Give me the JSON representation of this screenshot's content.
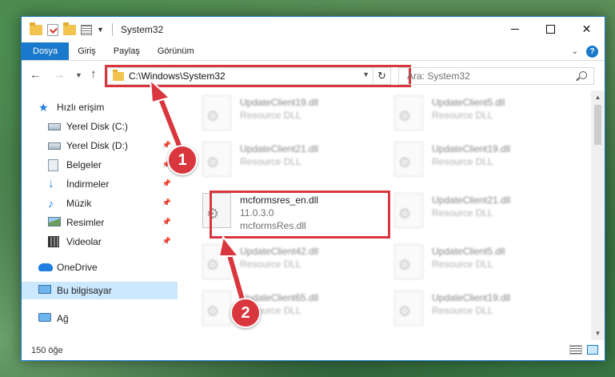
{
  "window": {
    "title": "System32",
    "controls": {
      "minimize": "",
      "maximize": "",
      "close": "✕"
    }
  },
  "ribbon": {
    "tabs": [
      "Dosya",
      "Giriş",
      "Paylaş",
      "Görünüm"
    ],
    "help": "?"
  },
  "address": {
    "path": "C:\\Windows\\System32",
    "search_placeholder": "Ara: System32"
  },
  "sidebar": {
    "items": [
      {
        "label": "Hızlı erişim",
        "icon": "star-icon",
        "pinned": false
      },
      {
        "label": "Yerel Disk (C:)",
        "icon": "drive-icon",
        "pinned": false
      },
      {
        "label": "Yerel Disk (D:)",
        "icon": "drive-icon",
        "pinned": true
      },
      {
        "label": "Belgeler",
        "icon": "documents-icon",
        "pinned": true
      },
      {
        "label": "İndirmeler",
        "icon": "downloads-icon",
        "pinned": true
      },
      {
        "label": "Müzik",
        "icon": "music-icon",
        "pinned": true
      },
      {
        "label": "Resimler",
        "icon": "pictures-icon",
        "pinned": true
      },
      {
        "label": "Videolar",
        "icon": "videos-icon",
        "pinned": true
      },
      {
        "label": "OneDrive",
        "icon": "onedrive-icon",
        "pinned": false
      },
      {
        "label": "Bu bilgisayar",
        "icon": "this-pc-icon",
        "pinned": false,
        "selected": true
      },
      {
        "label": "Ağ",
        "icon": "network-icon",
        "pinned": false
      }
    ]
  },
  "files": {
    "left_column": [
      {
        "name": "UpdateClient19.dll",
        "line2": "Resource DLL"
      },
      {
        "name": "UpdateClient21.dll",
        "line2": "Resource DLL"
      },
      {
        "name": "mcformsres_en.dll",
        "line2": "11.0.3.0",
        "line3": "mcformsRes.dll",
        "highlighted": true
      },
      {
        "name": "UpdateClient42.dll",
        "line2": "Resource DLL"
      },
      {
        "name": "UpdateClient65.dll",
        "line2": "Resource DLL"
      }
    ],
    "right_column": [
      {
        "name": "UpdateClient5.dll",
        "line2": "Resource DLL"
      },
      {
        "name": "UpdateClient19.dll",
        "line2": "Resource DLL"
      },
      {
        "name": "UpdateClient21.dll",
        "line2": "Resource DLL"
      },
      {
        "name": "UpdateClient5.dll",
        "line2": "Resource DLL"
      },
      {
        "name": "UpdateClient19.dll",
        "line2": "Resource DLL"
      }
    ]
  },
  "status": {
    "item_count": "150 öğe"
  },
  "callouts": {
    "step1": "1",
    "step2": "2"
  },
  "colors": {
    "accent": "#1979ca",
    "highlight": "#d9363e",
    "selection": "#cce8ff"
  }
}
